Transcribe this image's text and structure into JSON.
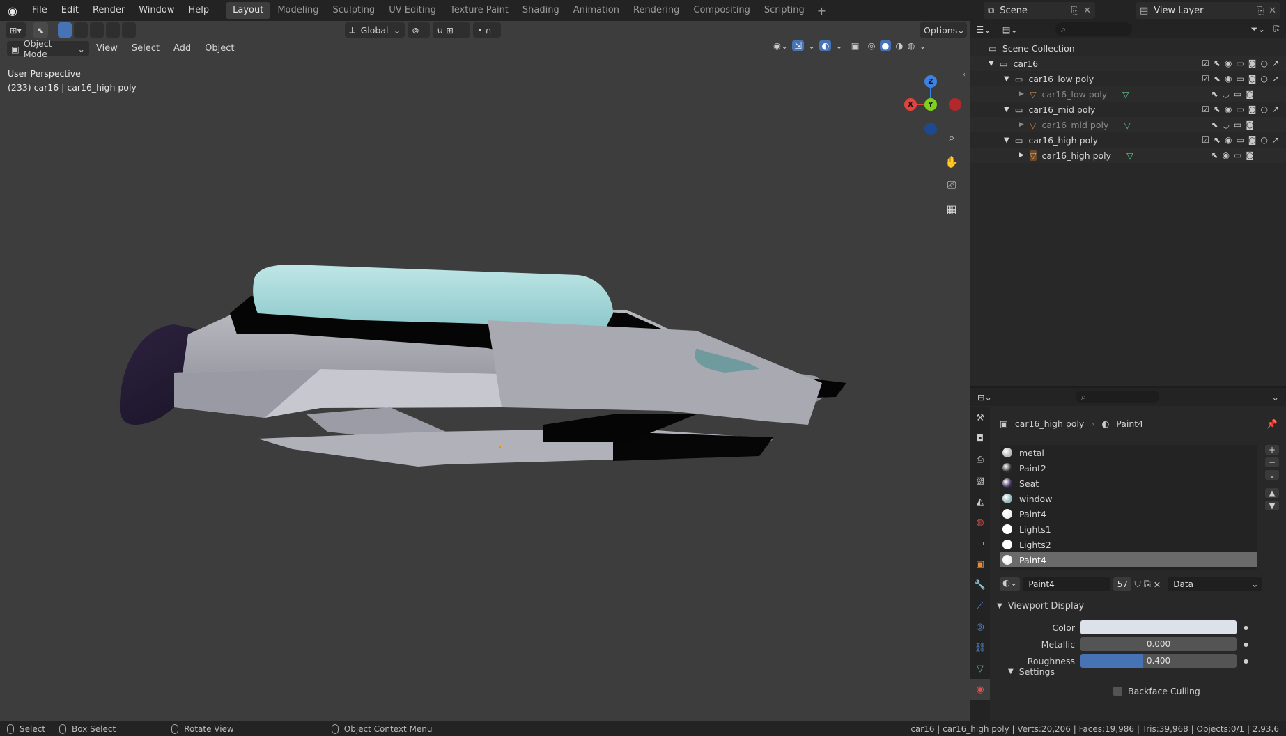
{
  "app": {
    "menus": [
      "File",
      "Edit",
      "Render",
      "Window",
      "Help"
    ],
    "workspaces": [
      "Layout",
      "Modeling",
      "Sculpting",
      "UV Editing",
      "Texture Paint",
      "Shading",
      "Animation",
      "Rendering",
      "Compositing",
      "Scripting"
    ],
    "active_workspace": "Layout",
    "scene": "Scene",
    "view_layer": "View Layer"
  },
  "viewport": {
    "transform_orientation": "Global",
    "options_label": "Options",
    "mode": "Object Mode",
    "menus": [
      "View",
      "Select",
      "Add",
      "Object"
    ],
    "perspective_label": "User Perspective",
    "object_label": "(233) car16 | car16_high poly",
    "gizmo": {
      "x": "X",
      "y": "Y",
      "z": "Z"
    }
  },
  "outliner": {
    "root": "Scene Collection",
    "items": [
      {
        "label": "car16",
        "level": 1,
        "type": "collection"
      },
      {
        "label": "car16_low poly",
        "level": 2,
        "type": "collection"
      },
      {
        "label": "car16_low poly",
        "level": 3,
        "type": "object",
        "dim": true
      },
      {
        "label": "car16_mid poly",
        "level": 2,
        "type": "collection"
      },
      {
        "label": "car16_mid poly",
        "level": 3,
        "type": "object",
        "dim": true
      },
      {
        "label": "car16_high poly",
        "level": 2,
        "type": "collection"
      },
      {
        "label": "car16_high poly",
        "level": 3,
        "type": "object",
        "dim": false
      }
    ]
  },
  "properties": {
    "breadcrumb_object": "car16_high poly",
    "breadcrumb_material": "Paint4",
    "materials": [
      {
        "name": "metal",
        "color": "#b8b8b8"
      },
      {
        "name": "Paint2",
        "color": "#2a2a2a"
      },
      {
        "name": "Seat",
        "color": "#3a2a5a"
      },
      {
        "name": "window",
        "color": "#8fb8b8"
      },
      {
        "name": "Paint4",
        "color": "#f0f0f0"
      },
      {
        "name": "Lights1",
        "color": "#ffffff"
      },
      {
        "name": "Lights2",
        "color": "#ffffff"
      },
      {
        "name": "Paint4",
        "color": "#f0f0f0",
        "selected": true
      }
    ],
    "material_name": "Paint4",
    "user_count": "57",
    "link": "Data",
    "viewport_display_label": "Viewport Display",
    "color_label": "Color",
    "metallic_label": "Metallic",
    "metallic_value": "0.000",
    "roughness_label": "Roughness",
    "roughness_value": "0.400",
    "roughness_fraction": 0.4,
    "settings_label": "Settings",
    "backface_culling_label": "Backface Culling"
  },
  "statusbar": {
    "select": "Select",
    "box_select": "Box Select",
    "rotate": "Rotate View",
    "context_menu": "Object Context Menu",
    "stats": "car16 | car16_high poly | Verts:20,206 | Faces:19,986 | Tris:39,968 | Objects:0/1 | 2.93.6"
  },
  "colors": {
    "accent_blue": "#4772b3",
    "axis_x": "#e0443e",
    "axis_y": "#7fcf1d",
    "axis_z": "#3b82e6"
  }
}
